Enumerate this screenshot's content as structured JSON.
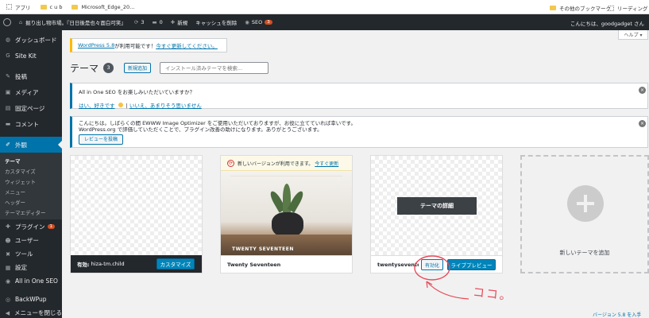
{
  "bookmarks": {
    "apps": "アプリ",
    "b1": "c u b",
    "b2": "Microsoft_Edge_20...",
    "other": "その他のブックマーク",
    "reading": "リーディング リ"
  },
  "adminbar": {
    "site": "掘り出し物市場。『日日後是也々面白可笑』",
    "updates": "3",
    "comments": "0",
    "new": "新規",
    "cache": "キャッシュを削除",
    "seo": "SEO",
    "seo_badge": "3",
    "greeting": "こんにちは、goodgadget さん"
  },
  "help_tab": "ヘルプ ▾",
  "sidebar": {
    "items": [
      {
        "icon": "◍",
        "label": "ダッシュボード"
      },
      {
        "icon": "G",
        "label": "Site Kit"
      },
      {
        "icon": "✎",
        "label": "投稿"
      },
      {
        "icon": "▣",
        "label": "メディア"
      },
      {
        "icon": "▤",
        "label": "固定ページ"
      },
      {
        "icon": "▬",
        "label": "コメント"
      }
    ],
    "appearance": {
      "icon": "✐",
      "label": "外観"
    },
    "sub": [
      "テーマ",
      "カスタマイズ",
      "ウィジェット",
      "メニュー",
      "ヘッダー",
      "テーマエディター"
    ],
    "plugins": {
      "icon": "✚",
      "label": "プラグイン",
      "badge": "1"
    },
    "bottom": [
      {
        "icon": "☻",
        "label": "ユーザー"
      },
      {
        "icon": "✖",
        "label": "ツール"
      },
      {
        "icon": "▦",
        "label": "設定"
      },
      {
        "icon": "◉",
        "label": "All in One SEO"
      },
      {
        "icon": "◎",
        "label": "BackWPup"
      },
      {
        "icon": "◀",
        "label": "メニューを閉じる"
      }
    ]
  },
  "update_notice": {
    "version": "WordPress 5.8",
    "text": " が利用可能です！",
    "link": "今すぐ更新してください。"
  },
  "header": {
    "title": "テーマ",
    "count": "3",
    "add_new": "新規追加",
    "search_placeholder": "インストール済みテーマを検索..."
  },
  "aioseo_notice": {
    "text": "All in One SEO をお楽しみいただいていますか？",
    "yes": "はい、好きです",
    "sep": " | ",
    "no": "いいえ、あまりそう思いません"
  },
  "ewww_notice": {
    "line1": "こんにちは。しばらくの間 EWWW Image Optimizer をご使用いただいておりますが、お役に立てていれば幸いです。",
    "line2": "WordPress.org で評価していただくことで、プラグイン改善の助けになります。ありがとうございます。",
    "button": "レビューを投稿"
  },
  "themes": [
    {
      "name": "hiza-tm.child",
      "active_prefix": "有効:",
      "customize": "カスタマイズ"
    },
    {
      "name": "Twenty Seventeen",
      "update_text": "新しいバージョンが利用できます。",
      "update_link": "今すぐ更新",
      "screenshot_label": "TWENTY SEVENTEEN"
    },
    {
      "name": "twentyseventeen-c",
      "details": "テーマの詳細",
      "activate": "有効化",
      "live_preview": "ライブプレビュー"
    }
  ],
  "add_theme": {
    "label": "新しいテーマを追加"
  },
  "annotation": {
    "text": "ココ。"
  },
  "footer": {
    "version": "バージョン 5.8 を入手"
  }
}
